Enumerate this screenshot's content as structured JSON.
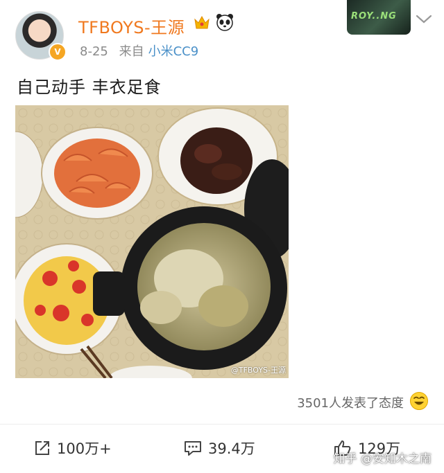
{
  "post": {
    "username": "TFBOYS-王源",
    "date": "8-25",
    "source_prefix": "来自",
    "source_device": "小米CC9",
    "verified_badge": "V",
    "text": "自己动手 丰衣足食",
    "image_watermark": "@TFBOYS-王源",
    "cover_text": "ROY..NG",
    "reactions_text": "3501人发表了态度"
  },
  "actions": {
    "share_count": "100万+",
    "comment_count": "39.4万",
    "like_count": "129万"
  },
  "overlay": {
    "zhihu_watermark": "知乎 @安知木之南"
  },
  "icons": [
    "crown-icon",
    "panda-icon",
    "chevron-down-icon",
    "share-icon",
    "comment-icon",
    "like-icon",
    "smiley-icon"
  ],
  "colors": {
    "username": "#f0791f",
    "source_link": "#4a90c8",
    "meta": "#8a8a8a"
  }
}
